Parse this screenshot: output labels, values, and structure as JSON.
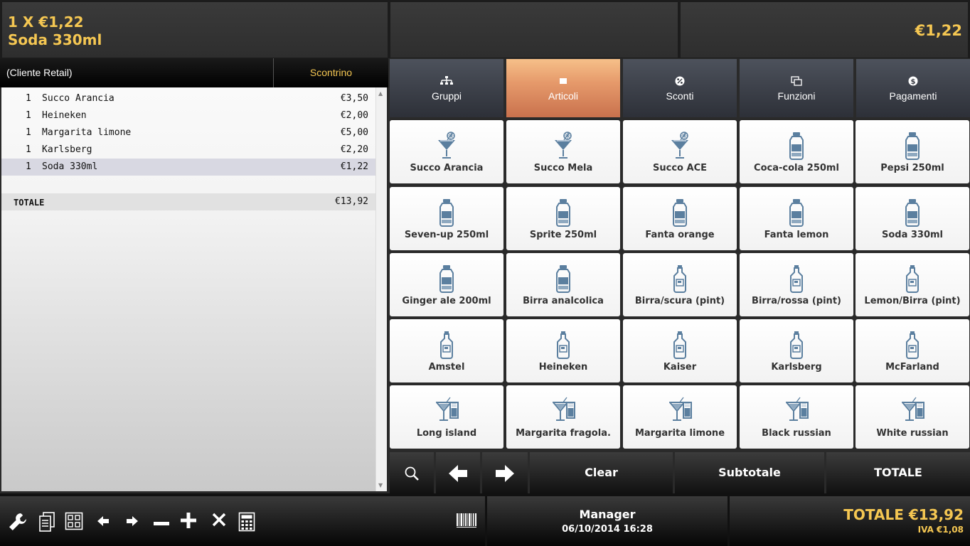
{
  "display": {
    "line1": "1 X €1,22",
    "line2": "Soda 330ml",
    "amount": "€1,22"
  },
  "receipt": {
    "client": "(Cliente Retail)",
    "tab": "Scontrino",
    "rows": [
      {
        "qty": "1",
        "name": "Succo Arancia",
        "price": "€3,50"
      },
      {
        "qty": "1",
        "name": "Heineken",
        "price": "€2,00"
      },
      {
        "qty": "1",
        "name": "Margarita limone",
        "price": "€5,00"
      },
      {
        "qty": "1",
        "name": "Karlsberg",
        "price": "€2,20"
      },
      {
        "qty": "1",
        "name": "Soda 330ml",
        "price": "€1,22",
        "selected": true
      }
    ],
    "total_label": "TOTALE",
    "total_value": "€13,92"
  },
  "tabs": [
    {
      "label": "Gruppi",
      "icon": "hierarchy-icon",
      "active": false
    },
    {
      "label": "Articoli",
      "icon": "square-icon",
      "active": true
    },
    {
      "label": "Sconti",
      "icon": "percent-icon",
      "active": false
    },
    {
      "label": "Funzioni",
      "icon": "windows-icon",
      "active": false
    },
    {
      "label": "Pagamenti",
      "icon": "dollar-icon",
      "active": false
    }
  ],
  "products": [
    {
      "name": "Succo Arancia",
      "icon": "cocktail-glass-icon"
    },
    {
      "name": "Succo Mela",
      "icon": "cocktail-glass-icon"
    },
    {
      "name": "Succo ACE",
      "icon": "cocktail-glass-icon"
    },
    {
      "name": "Coca-cola 250ml",
      "icon": "bottle-icon"
    },
    {
      "name": "Pepsi 250ml",
      "icon": "bottle-icon"
    },
    {
      "name": "Seven-up 250ml",
      "icon": "bottle-icon"
    },
    {
      "name": "Sprite 250ml",
      "icon": "bottle-icon"
    },
    {
      "name": "Fanta orange",
      "icon": "bottle-icon"
    },
    {
      "name": "Fanta lemon",
      "icon": "bottle-icon"
    },
    {
      "name": "Soda 330ml",
      "icon": "bottle-icon"
    },
    {
      "name": "Ginger ale 200ml",
      "icon": "bottle-icon"
    },
    {
      "name": "Birra analcolica",
      "icon": "bottle-icon"
    },
    {
      "name": "Birra/scura (pint)",
      "icon": "beer-bottle-icon"
    },
    {
      "name": "Birra/rossa (pint)",
      "icon": "beer-bottle-icon"
    },
    {
      "name": "Lemon/Birra (pint)",
      "icon": "beer-bottle-icon"
    },
    {
      "name": "Amstel",
      "icon": "beer-bottle-icon"
    },
    {
      "name": "Heineken",
      "icon": "beer-bottle-icon"
    },
    {
      "name": "Kaiser",
      "icon": "beer-bottle-icon"
    },
    {
      "name": "Karlsberg",
      "icon": "beer-bottle-icon"
    },
    {
      "name": "McFarland",
      "icon": "beer-bottle-icon"
    },
    {
      "name": "Long island",
      "icon": "martini-icon"
    },
    {
      "name": "Margarita fragola.",
      "icon": "martini-icon"
    },
    {
      "name": "Margarita limone",
      "icon": "martini-icon"
    },
    {
      "name": "Black russian",
      "icon": "martini-icon"
    },
    {
      "name": "White russian",
      "icon": "martini-icon"
    }
  ],
  "actions": {
    "search_icon": "search-icon",
    "prev_icon": "arrow-left-icon",
    "next_icon": "arrow-right-icon",
    "clear": "Clear",
    "subtotal": "Subtotale",
    "total": "TOTALE"
  },
  "toolbar": {
    "icons": [
      "wrench-icon",
      "documents-icon",
      "grid-icon",
      "arrow-left-icon",
      "arrow-right-icon",
      "minus-icon",
      "plus-icon",
      "close-icon",
      "calculator-icon",
      "barcode-icon"
    ]
  },
  "status": {
    "user": "Manager",
    "datetime": "06/10/2014 16:28",
    "total": "TOTALE €13,92",
    "iva": "IVA €1,08"
  },
  "colors": {
    "accent": "#f5c752",
    "active_tab": "#e69a6b",
    "icon_blue": "#5b7f9f"
  }
}
